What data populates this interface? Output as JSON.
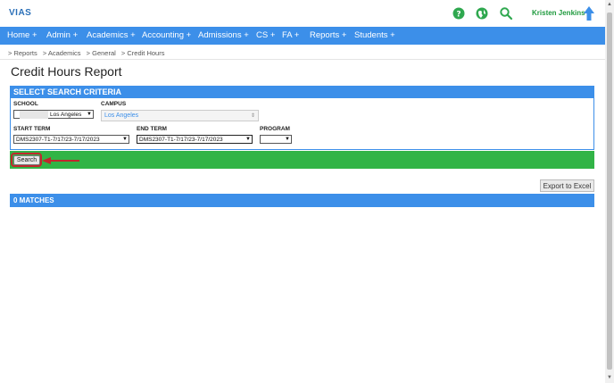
{
  "header": {
    "logo": "VIAS",
    "help_icon": "help-icon",
    "globe_icon": "globe-icon",
    "search_icon": "search-icon",
    "user_name": "Kristen Jenkins",
    "user_icon": "up-arrow-icon"
  },
  "nav": {
    "items": [
      {
        "label": "Home +"
      },
      {
        "label": "Admin +"
      },
      {
        "label": "Academics +"
      },
      {
        "label": "Accounting +"
      },
      {
        "label": "Admissions +"
      },
      {
        "label": "CS +"
      },
      {
        "label": "FA +"
      },
      {
        "label": "Reports +"
      },
      {
        "label": "Students +"
      }
    ]
  },
  "breadcrumb": [
    "> Reports",
    "> Academics",
    "> General",
    "> Credit Hours"
  ],
  "page_title": "Credit Hours Report",
  "criteria": {
    "header": "SELECT SEARCH CRITERIA",
    "school_label": "SCHOOL",
    "school_value": "Los Angeles",
    "campus_label": "CAMPUS",
    "campus_value": "Los Angeles",
    "start_term_label": "START TERM",
    "start_term_value": "DMS2307-T1-7/17/23-7/17/2023",
    "end_term_label": "END TERM",
    "end_term_value": "DMS2307-T1-7/17/23-7/17/2023",
    "program_label": "PROGRAM",
    "program_value": ""
  },
  "actions": {
    "search_label": "Search",
    "export_label": "Export to Excel"
  },
  "results": {
    "matches_label": "0 MATCHES"
  },
  "colors": {
    "nav_blue": "#3c8fe9",
    "action_green": "#31b446",
    "highlight_red": "#c1272d"
  }
}
